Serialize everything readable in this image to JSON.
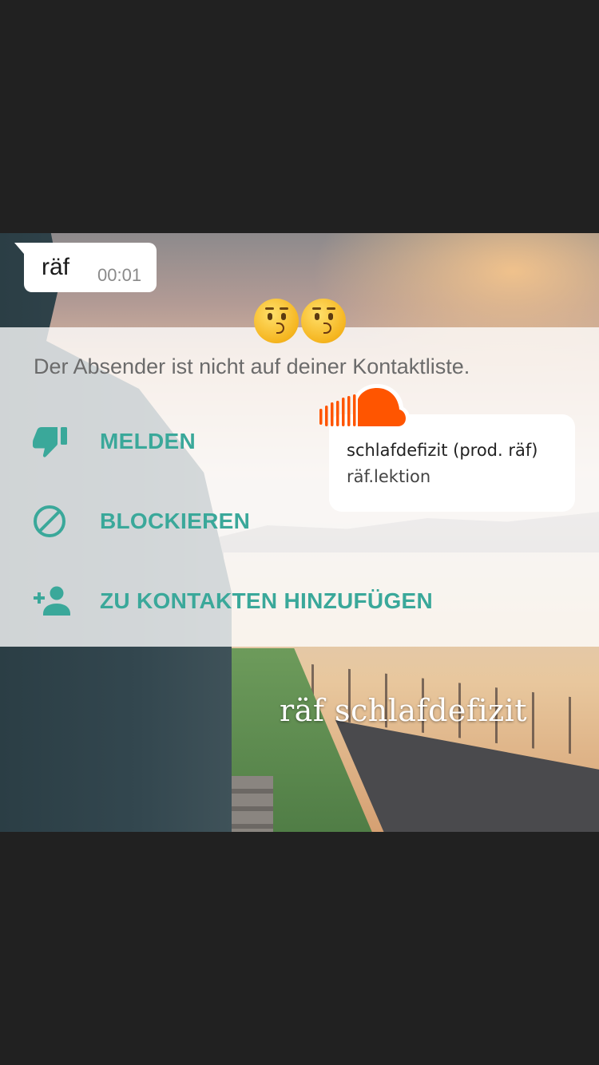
{
  "chat": {
    "sender": "räf",
    "time": "00:01"
  },
  "notice": "Der Absender ist nicht auf deiner Kontaktliste.",
  "actions": [
    {
      "label": "MELDEN",
      "icon": "thumbs-down-icon"
    },
    {
      "label": "BLOCKIEREN",
      "icon": "block-icon"
    },
    {
      "label": "ZU KONTAKTEN HINZUFÜGEN",
      "icon": "add-contact-icon"
    }
  ],
  "soundcloud": {
    "title": "schlafdefizit (prod. räf)",
    "artist": "räf.lektion",
    "icon": "soundcloud-icon",
    "accent": "#ff5500"
  },
  "stickers": [
    "kissing-face-emoji",
    "kissing-face-emoji"
  ],
  "caption": "räf schlafdefizit",
  "colors": {
    "accent": "#3aa89a",
    "background": "#212121"
  }
}
